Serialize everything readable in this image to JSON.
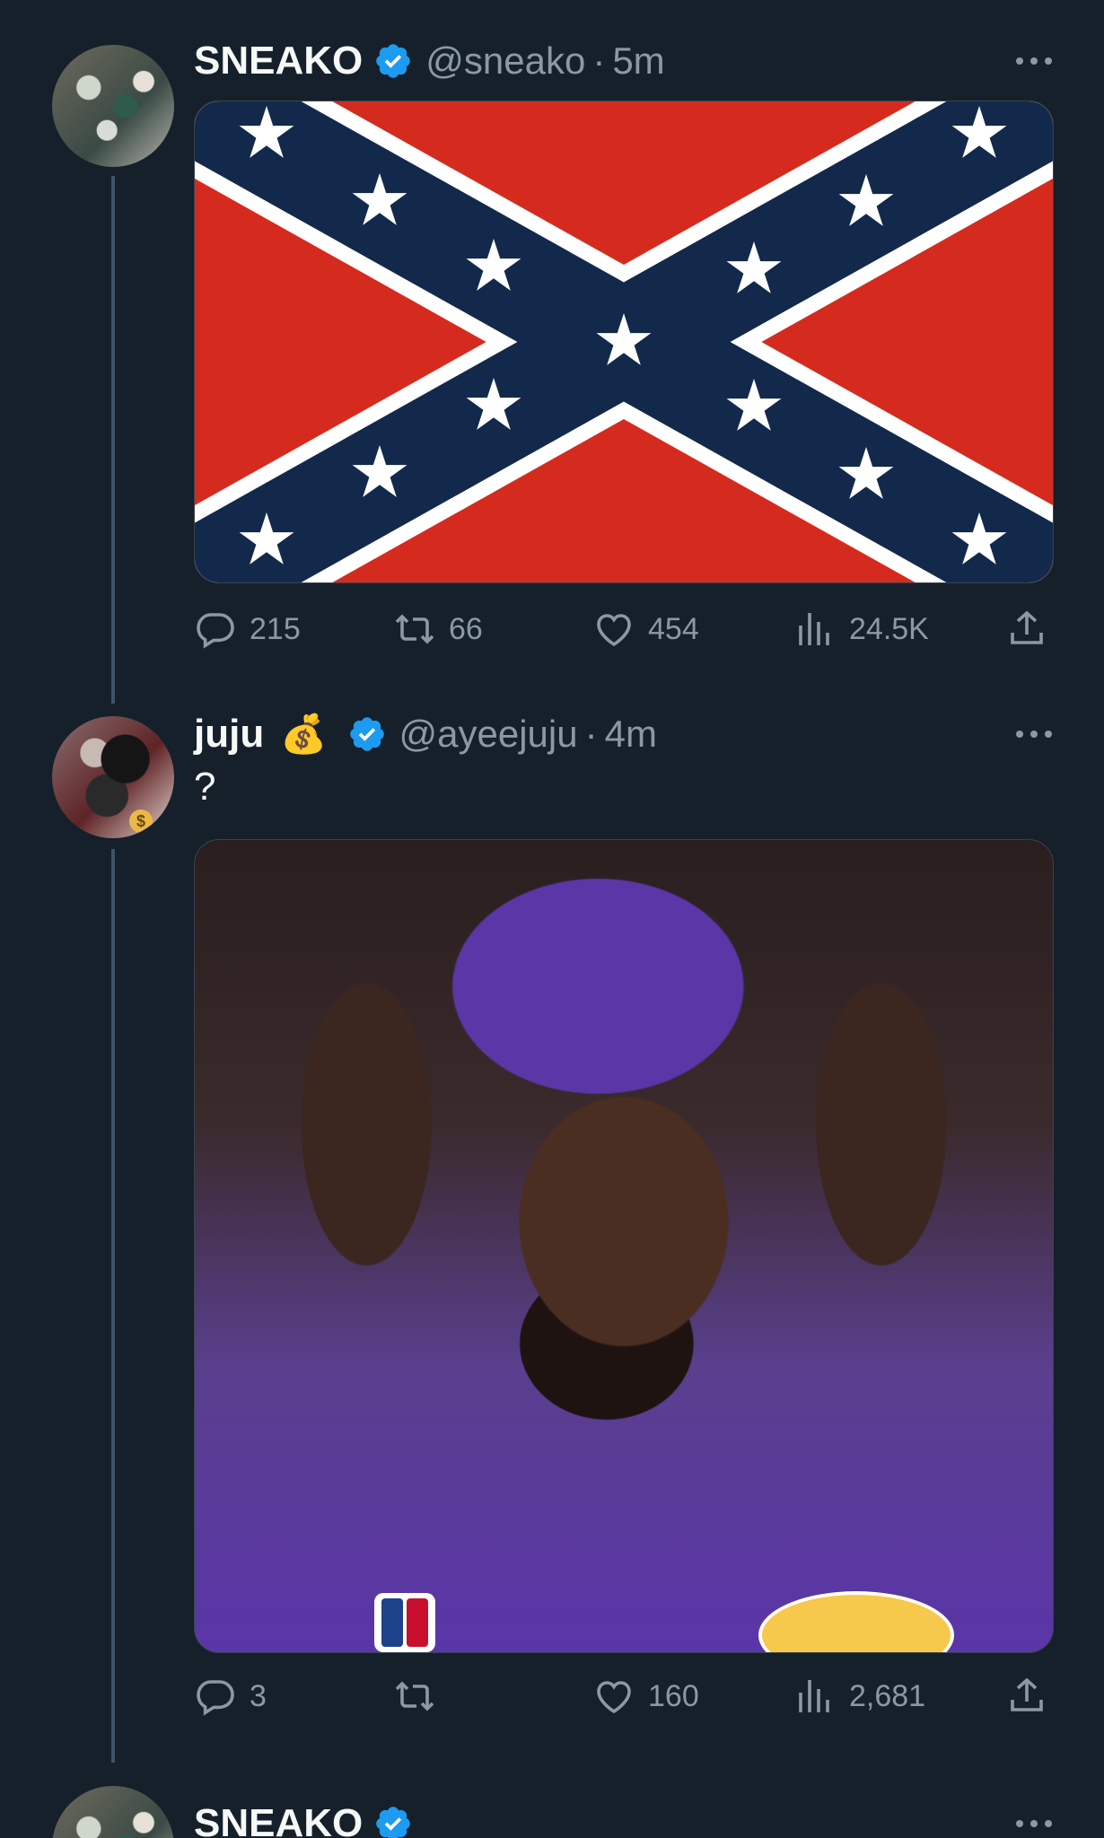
{
  "tweets": [
    {
      "name": "SNEAKO",
      "handle": "@sneako",
      "time": "5m",
      "text": "",
      "media": "confederate-flag-image",
      "stats": {
        "replies": "215",
        "retweets": "66",
        "likes": "454",
        "views": "24.5K"
      }
    },
    {
      "name": "juju",
      "emoji": "💰",
      "handle": "@ayeejuju",
      "time": "4m",
      "text": "?",
      "media": "lebron-hands-on-head-image",
      "stats": {
        "replies": "3",
        "retweets": "",
        "likes": "160",
        "views": "2,681"
      }
    },
    {
      "name": "SNEAKO",
      "handle": "",
      "time": ""
    }
  ],
  "separator": "·",
  "colors": {
    "background": "#15202b",
    "verified": "#1d9bf0",
    "secondary_text": "#8b98a5",
    "thread_line": "#3d5466"
  },
  "icons": [
    "reply-icon",
    "retweet-icon",
    "like-icon",
    "views-icon",
    "share-icon",
    "verified-badge-icon",
    "more-icon"
  ]
}
